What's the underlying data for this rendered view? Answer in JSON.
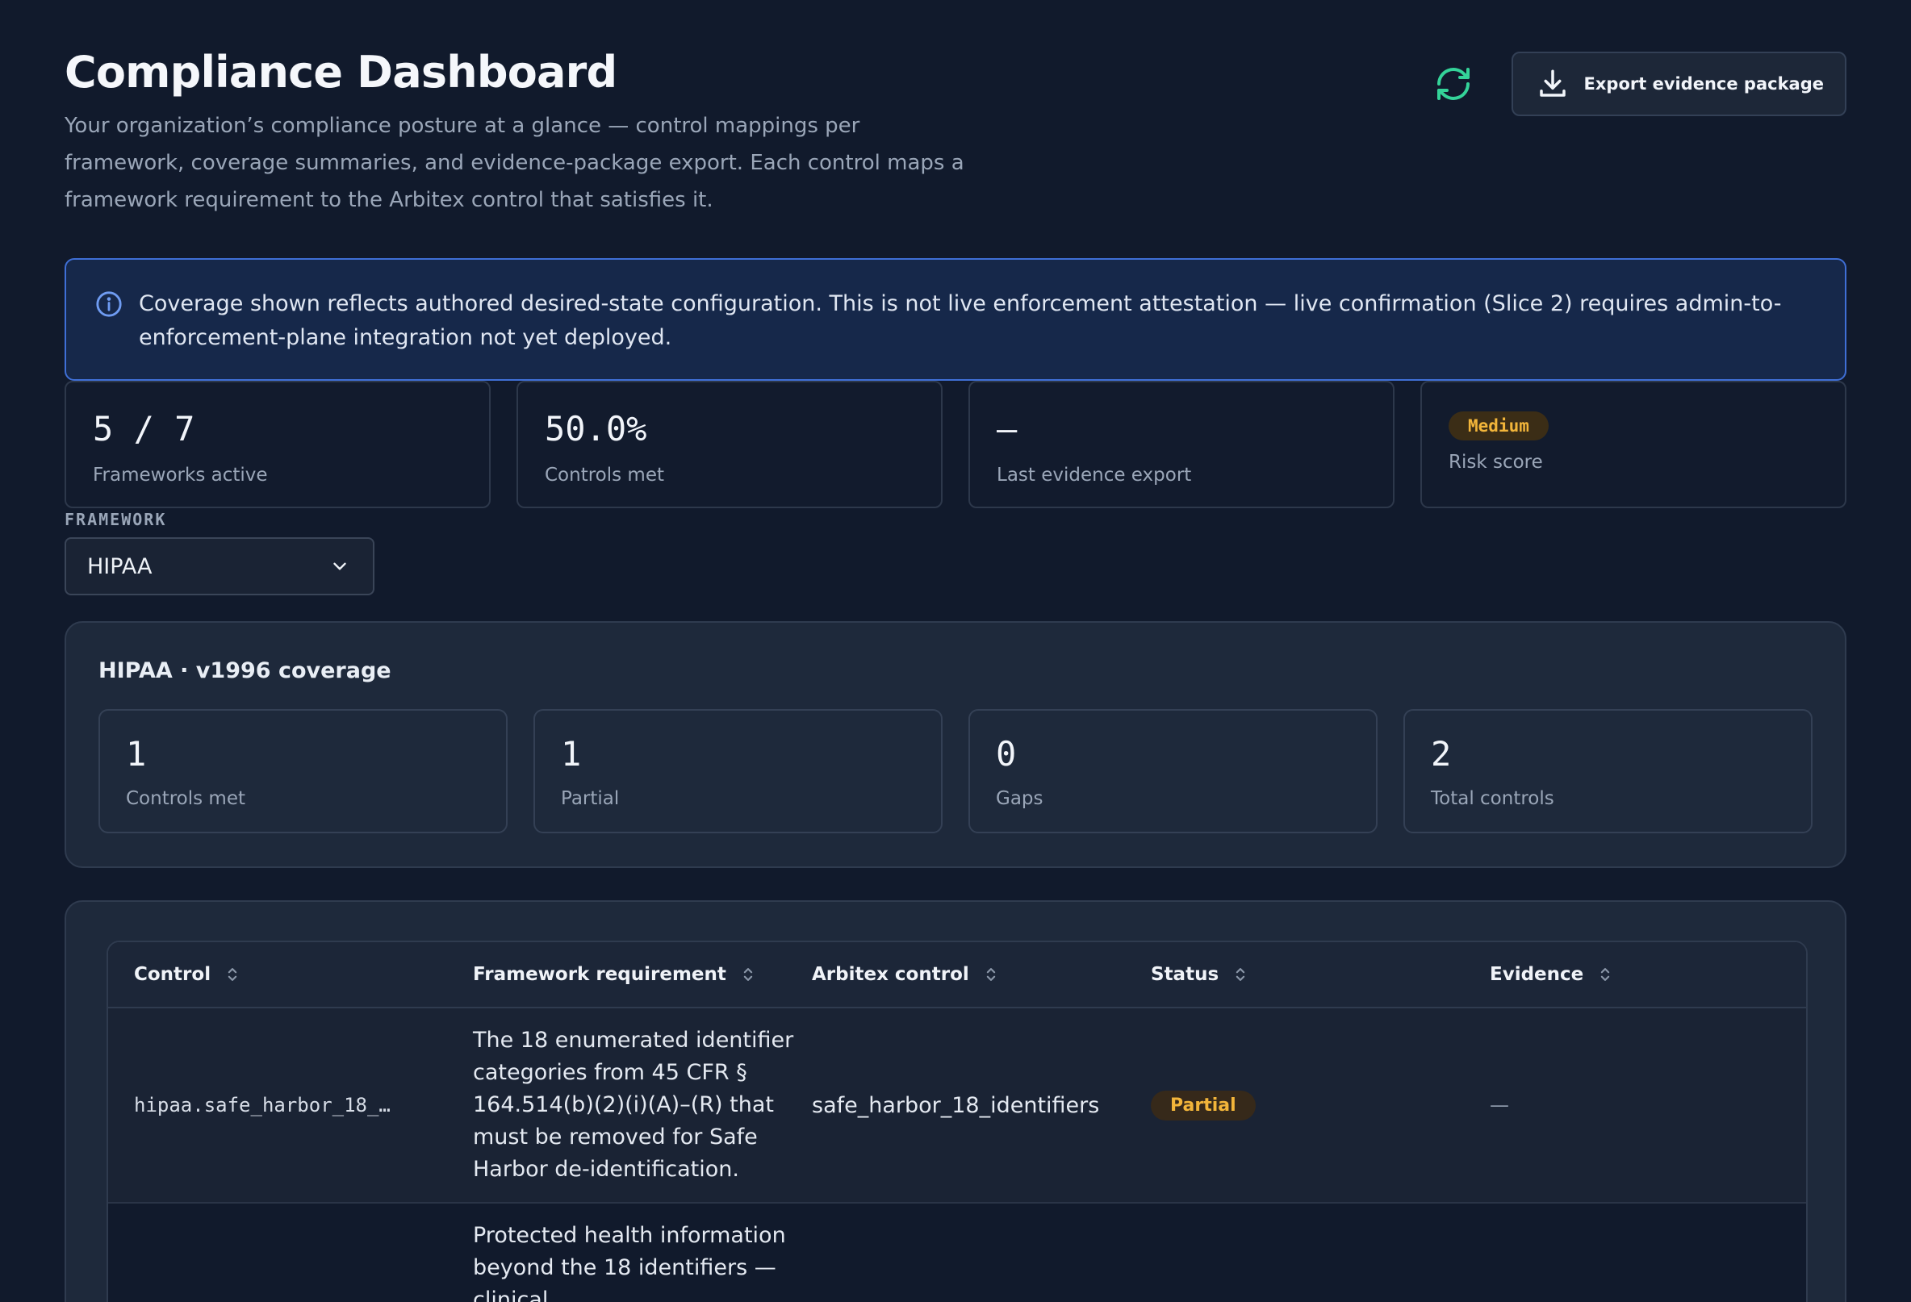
{
  "header": {
    "title": "Compliance Dashboard",
    "subtitle": "Your organization’s compliance posture at a glance — control mappings per framework, coverage summaries, and evidence-package export. Each control maps a framework requirement to the Arbitex control that satisfies it.",
    "export_label": "Export evidence package",
    "refresh_icon": "refresh-icon",
    "export_icon": "download-icon"
  },
  "notice": {
    "icon": "info-icon",
    "text": "Coverage shown reflects authored desired-state configuration. This is not live enforcement attestation — live confirmation (Slice 2) requires admin-to-enforcement-plane integration not yet deployed."
  },
  "stats": {
    "frameworks": {
      "value": "5 / 7",
      "label": "Frameworks active"
    },
    "controls": {
      "value": "50.0%",
      "label": "Controls met"
    },
    "export": {
      "value": "—",
      "label": "Last evidence export"
    },
    "risk": {
      "value": "Medium",
      "label": "Risk score"
    }
  },
  "framework": {
    "label": "FRAMEWORK",
    "selected": "HIPAA"
  },
  "coverage": {
    "title": "HIPAA · v1996 coverage",
    "cards": [
      {
        "value": "1",
        "label": "Controls met"
      },
      {
        "value": "1",
        "label": "Partial"
      },
      {
        "value": "0",
        "label": "Gaps"
      },
      {
        "value": "2",
        "label": "Total controls"
      }
    ]
  },
  "table": {
    "columns": [
      "Control",
      "Framework requirement",
      "Arbitex control",
      "Status",
      "Evidence"
    ],
    "rows": [
      {
        "control": "hipaa.safe_harbor_18_…",
        "requirement": "The 18 enumerated identifier categories from 45 CFR § 164.514(b)(2)(i)(A)–(R) that must be removed for Safe Harbor de-identification.",
        "arbitex": "safe_harbor_18_identifiers",
        "status": "Partial",
        "evidence": "—"
      },
      {
        "control": "",
        "requirement": "Protected health information beyond the 18 identifiers — clinical",
        "arbitex": "",
        "status": "",
        "evidence": ""
      }
    ]
  },
  "colors": {
    "background": "#111a2c",
    "accent_green": "#34d399",
    "notice_border": "#3f6fd6",
    "warning": "#f2b53a"
  }
}
